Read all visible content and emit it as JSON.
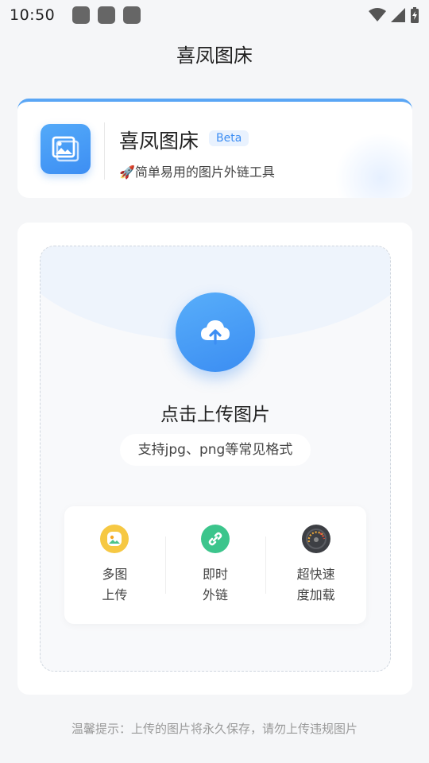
{
  "status_bar": {
    "time": "10:50",
    "icons": [
      "app-icon-1",
      "app-icon-2",
      "app-icon-3",
      "wifi-icon",
      "signal-icon",
      "battery-icon"
    ]
  },
  "app_bar": {
    "title": "喜凤图床"
  },
  "header": {
    "name": "喜凤图床",
    "badge": "Beta",
    "subtitle": "🚀简单易用的图片外链工具",
    "icon": "image-gallery-icon"
  },
  "upload": {
    "icon": "cloud-upload-icon",
    "title": "点击上传图片",
    "hint": "支持jpg、png等常见格式"
  },
  "features": [
    {
      "line1": "多图",
      "line2": "上传",
      "icon": "picture-icon"
    },
    {
      "line1": "即时",
      "line2": "外链",
      "icon": "link-icon"
    },
    {
      "line1": "超快速",
      "line2": "度加载",
      "icon": "speedometer-icon"
    }
  ],
  "footer": {
    "tip": "温馨提示：上传的图片将永久保存，请勿上传违规图片"
  },
  "colors": {
    "accent": "#3d8ef3",
    "background": "#f5f6f8"
  }
}
